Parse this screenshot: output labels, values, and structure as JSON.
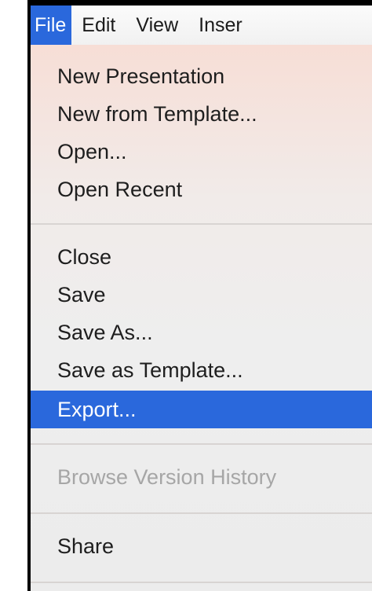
{
  "menubar": {
    "items": [
      {
        "label": "File"
      },
      {
        "label": "Edit"
      },
      {
        "label": "View"
      },
      {
        "label": "Inser"
      }
    ]
  },
  "file_menu": {
    "groups": [
      [
        "New Presentation",
        "New from Template...",
        "Open...",
        "Open Recent"
      ],
      [
        "Close",
        "Save",
        "Save As...",
        "Save as Template...",
        "Export..."
      ],
      [
        "Browse Version History"
      ],
      [
        "Share"
      ]
    ],
    "highlighted": "Export...",
    "disabled": [
      "Browse Version History"
    ]
  },
  "colors": {
    "highlight": "#2a68dc",
    "disabled_text": "#a6a6a6",
    "menu_top_tint": "#f7ded6"
  }
}
